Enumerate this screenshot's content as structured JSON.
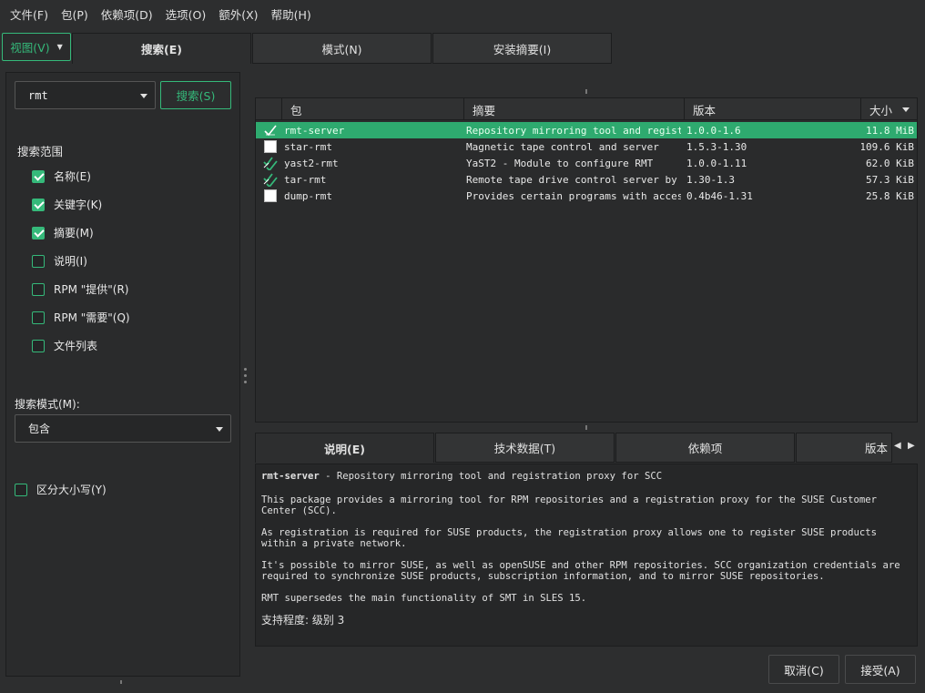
{
  "menubar": {
    "items": [
      "文件(F)",
      "包(P)",
      "依赖项(D)",
      "选项(O)",
      "额外(X)",
      "帮助(H)"
    ]
  },
  "topbar": {
    "view_label": "视图(V)",
    "tabs": [
      {
        "label": "搜索(E)",
        "active": true
      },
      {
        "label": "模式(N)",
        "active": false
      },
      {
        "label": "安装摘要(I)",
        "active": false
      }
    ]
  },
  "search": {
    "query": "rmt",
    "button_label": "搜索(S)",
    "scope_title": "搜索范围",
    "scopes": [
      {
        "label": "名称(E)",
        "checked": true
      },
      {
        "label": "关键字(K)",
        "checked": true
      },
      {
        "label": "摘要(M)",
        "checked": true
      },
      {
        "label": "说明(I)",
        "checked": false
      },
      {
        "label": "RPM \"提供\"(R)",
        "checked": false
      },
      {
        "label": "RPM \"需要\"(Q)",
        "checked": false
      },
      {
        "label": "文件列表",
        "checked": false
      }
    ],
    "mode_label": "搜索模式(M):",
    "mode_value": "包含",
    "case_sensitive_label": "区分大小写(Y)",
    "case_sensitive": false
  },
  "table": {
    "columns": [
      "包",
      "摘要",
      "版本",
      "大小"
    ],
    "rows": [
      {
        "status": "installed",
        "name": "rmt-server",
        "summary": "Repository mirroring tool and registr…",
        "version": "1.0.0-1.6",
        "size": "11.8 MiB",
        "selected": true
      },
      {
        "status": "available",
        "name": "star-rmt",
        "summary": "Magnetic tape control and server",
        "version": "1.5.3-1.30",
        "size": "109.6 KiB",
        "selected": false
      },
      {
        "status": "protected",
        "name": "yast2-rmt",
        "summary": "YaST2 - Module to configure RMT",
        "version": "1.0.0-1.11",
        "size": "62.0 KiB",
        "selected": false
      },
      {
        "status": "protected",
        "name": "tar-rmt",
        "summary": "Remote tape drive control server by GNU",
        "version": "1.30-1.3",
        "size": "57.3 KiB",
        "selected": false
      },
      {
        "status": "available",
        "name": "dump-rmt",
        "summary": "Provides certain programs with access…",
        "version": "0.4b46-1.31",
        "size": "25.8 KiB",
        "selected": false
      }
    ]
  },
  "details": {
    "tabs": [
      "说明(E)",
      "技术数据(T)",
      "依赖项",
      "版本"
    ],
    "package_name": "rmt-server",
    "headline_rest": " - Repository mirroring tool and registration proxy for SCC",
    "paragraphs": [
      "This package provides a mirroring tool for RPM repositories and a registration proxy for the SUSE Customer Center (SCC).",
      "As registration is required for SUSE products, the registration proxy allows one to register SUSE products within a private network.",
      "It's possible to mirror SUSE, as well as openSUSE and other RPM repositories. SCC organization credentials are required to synchronize SUSE products, subscription information, and to mirror SUSE repositories.",
      "RMT supersedes the main functionality of SMT in SLES 15."
    ],
    "support_level": "支持程度: 级别 3"
  },
  "footer": {
    "cancel_label": "取消(C)",
    "accept_label": "接受(A)"
  },
  "colors": {
    "accent": "#35b97a",
    "selection": "#2eaa6f",
    "background": "#2d2e2f"
  }
}
